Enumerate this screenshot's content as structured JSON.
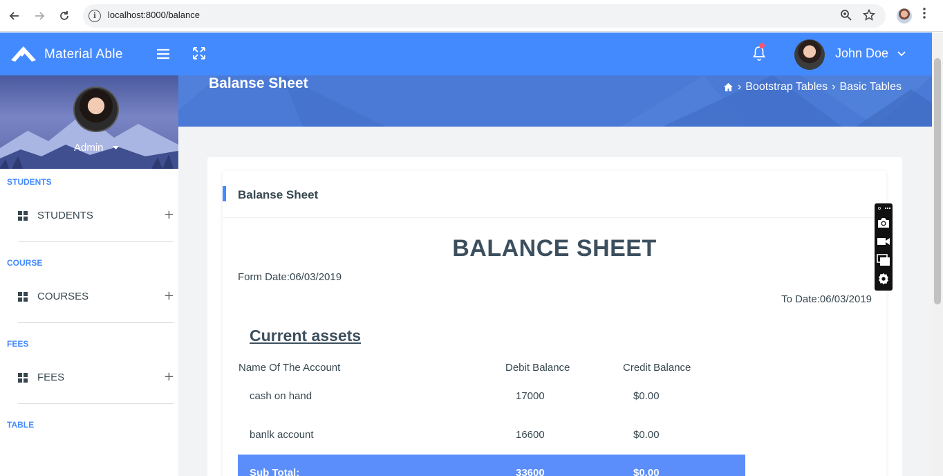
{
  "browser": {
    "url": "localhost:8000/balance",
    "back_icon": "arrow-left-icon",
    "forward_icon": "arrow-right-icon",
    "reload_icon": "reload-icon"
  },
  "header": {
    "brand": "Material Able",
    "user_name": "John Doe"
  },
  "sidebar": {
    "profile_name": "Admin",
    "sections": [
      {
        "title": "STUDENTS",
        "item": "STUDENTS"
      },
      {
        "title": "COURSE",
        "item": "COURSES"
      },
      {
        "title": "FEES",
        "item": "FEES"
      },
      {
        "title": "TABLE"
      }
    ]
  },
  "page": {
    "banner_title": "Balanse Sheet",
    "breadcrumbs": [
      "Bootstrap Tables",
      "Basic Tables"
    ],
    "card_title": "Balanse Sheet",
    "sheet_title": "BALANCE SHEET",
    "from_date": "Form Date:06/03/2019",
    "to_date": "To Date:06/03/2019",
    "section_title": "Current assets",
    "table": {
      "headers": [
        "Name Of The Account",
        "Debit Balance",
        "Credit Balance"
      ],
      "rows": [
        {
          "name": "cash on hand",
          "debit": "17000",
          "credit": "$0.00"
        },
        {
          "name": "banlk account",
          "debit": "16600",
          "credit": "$0.00"
        }
      ],
      "subtotal": {
        "label": "Sub Total:",
        "debit": "33600",
        "credit": "$0.00"
      }
    }
  },
  "colors": {
    "header_blue": "#448aff",
    "banner_blue": "#4a7ad6",
    "subtotal_blue": "#5b8dfb",
    "notification_dot": "#ff5370"
  }
}
